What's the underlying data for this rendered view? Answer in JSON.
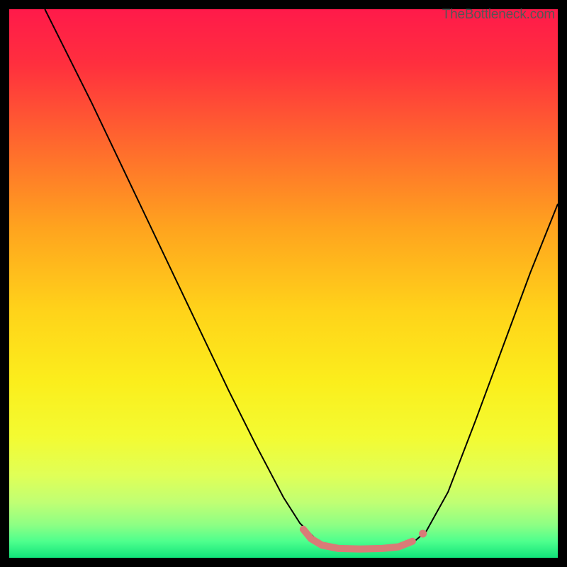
{
  "watermark": "TheBottleneck.com",
  "chart_data": {
    "type": "line",
    "title": "",
    "xlabel": "",
    "ylabel": "",
    "xlim": [
      0,
      100
    ],
    "ylim": [
      0,
      100
    ],
    "gradient_stops": [
      {
        "offset": 0.0,
        "color": "#ff1a4a"
      },
      {
        "offset": 0.1,
        "color": "#ff2f3e"
      },
      {
        "offset": 0.25,
        "color": "#ff6a2d"
      },
      {
        "offset": 0.4,
        "color": "#ffa41e"
      },
      {
        "offset": 0.55,
        "color": "#ffd31a"
      },
      {
        "offset": 0.68,
        "color": "#fbee1c"
      },
      {
        "offset": 0.78,
        "color": "#f3fb32"
      },
      {
        "offset": 0.85,
        "color": "#e0ff57"
      },
      {
        "offset": 0.9,
        "color": "#bfff74"
      },
      {
        "offset": 0.94,
        "color": "#8dff84"
      },
      {
        "offset": 0.97,
        "color": "#4eff8d"
      },
      {
        "offset": 1.0,
        "color": "#11e47a"
      }
    ],
    "series": [
      {
        "name": "bottleneck-curve",
        "type": "line",
        "stroke": "#000000",
        "stroke_width": 2,
        "points_xy": [
          [
            6.5,
            100.0
          ],
          [
            10.0,
            93.0
          ],
          [
            15.0,
            83.0
          ],
          [
            20.0,
            72.5
          ],
          [
            25.0,
            62.0
          ],
          [
            30.0,
            51.5
          ],
          [
            35.0,
            41.0
          ],
          [
            40.0,
            30.5
          ],
          [
            45.0,
            20.5
          ],
          [
            50.0,
            11.0
          ],
          [
            53.0,
            6.3
          ],
          [
            56.0,
            3.3
          ],
          [
            58.5,
            2.0
          ],
          [
            62.0,
            1.7
          ],
          [
            66.0,
            1.7
          ],
          [
            70.0,
            1.8
          ],
          [
            73.5,
            2.7
          ],
          [
            76.0,
            4.8
          ],
          [
            80.0,
            12.0
          ],
          [
            85.0,
            25.0
          ],
          [
            90.0,
            38.5
          ],
          [
            95.0,
            52.0
          ],
          [
            100.0,
            64.5
          ]
        ]
      },
      {
        "name": "bottom-highlight",
        "type": "line",
        "stroke": "#d97b77",
        "stroke_width": 10,
        "stroke_linecap": "round",
        "points_xy": [
          [
            53.6,
            5.2
          ],
          [
            55.0,
            3.5
          ],
          [
            57.0,
            2.3
          ],
          [
            60.0,
            1.7
          ],
          [
            64.0,
            1.6
          ],
          [
            68.0,
            1.7
          ],
          [
            71.0,
            2.0
          ],
          [
            73.5,
            3.0
          ]
        ]
      },
      {
        "name": "bottom-dot",
        "type": "scatter",
        "stroke": "#d97b77",
        "radius": 5.5,
        "points_xy": [
          [
            75.4,
            4.4
          ]
        ]
      }
    ]
  }
}
